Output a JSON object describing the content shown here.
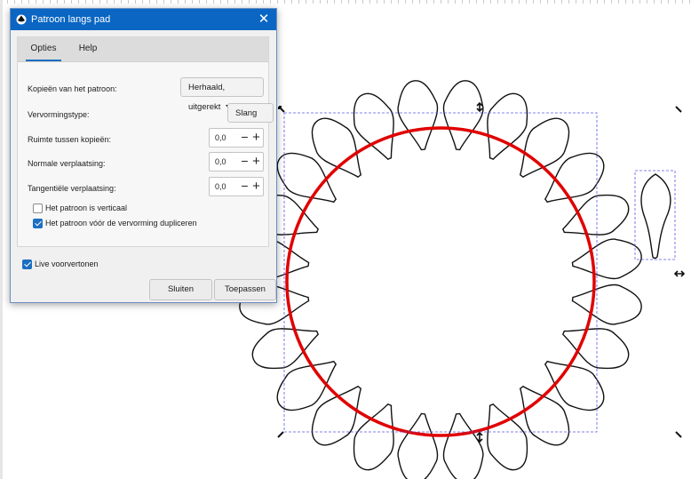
{
  "dialog": {
    "title": "Patroon langs pad",
    "tabs": [
      "Opties",
      "Help"
    ],
    "rows": [
      {
        "label": "Kopieën van het patroon:",
        "control": "dropdown",
        "value": "Herhaald, uitgerekt"
      },
      {
        "label": "Vervormingstype:",
        "control": "dropdown",
        "value": "Slang"
      },
      {
        "label": "Ruimte tussen kopieën:",
        "control": "spin",
        "value": "0,0"
      },
      {
        "label": "Normale verplaatsing:",
        "control": "spin",
        "value": "0,0"
      },
      {
        "label": "Tangentiële verplaatsing:",
        "control": "spin",
        "value": "0,0"
      }
    ],
    "checkboxes": [
      {
        "label": "Het patroon is verticaal",
        "checked": false
      },
      {
        "label": "Het patroon vóór de vervorming dupliceren",
        "checked": true
      }
    ],
    "live_preview": {
      "label": "Live voorvertonen",
      "checked": true
    },
    "buttons": {
      "close": "Sluiten",
      "apply": "Toepassen"
    }
  },
  "canvas": {
    "path_color": "#e00000",
    "pattern_stroke_color": "#111111",
    "selection_color": "#5a5ae6",
    "petal_count": 24,
    "icons": [
      "scale-handle-icon",
      "rotate-handle-icon",
      "close-icon"
    ]
  }
}
